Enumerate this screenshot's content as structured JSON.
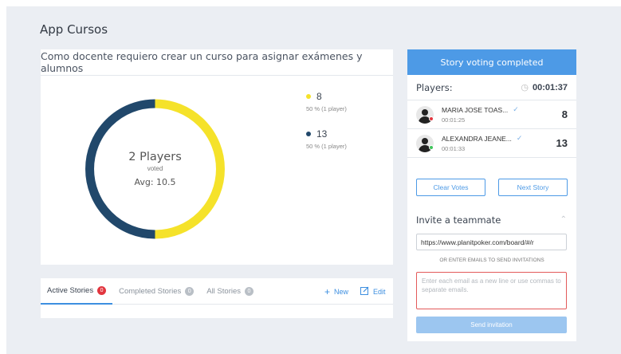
{
  "app_title": "App Cursos",
  "story": {
    "title": "Como docente requiero crear un curso para asignar exámenes y alumnos",
    "summary": {
      "players": "2 Players",
      "voted": "voted",
      "avg": "Avg: 10.5"
    },
    "legend": [
      {
        "value": "8",
        "detail": "50 % (1 player)",
        "color": "#f5e22a"
      },
      {
        "value": "13",
        "detail": "50 % (1 player)",
        "color": "#21486b"
      }
    ]
  },
  "chart_data": {
    "type": "pie",
    "categories": [
      "8",
      "13"
    ],
    "values": [
      50,
      50
    ],
    "colors": [
      "#f5e22a",
      "#21486b"
    ]
  },
  "tabs": {
    "items": [
      {
        "label": "Active Stories",
        "count": "0",
        "active": true
      },
      {
        "label": "Completed Stories",
        "count": "0",
        "active": false
      },
      {
        "label": "All Stories",
        "count": "0",
        "active": false
      }
    ],
    "new_label": "New",
    "edit_label": "Edit"
  },
  "sidebar": {
    "banner": "Story voting completed",
    "players_label": "Players:",
    "timer": "00:01:37",
    "players": [
      {
        "name": "MARIA JOSE TOAS...",
        "time": "00:01:25",
        "vote": "8",
        "status_color": "#e2363f"
      },
      {
        "name": "ALEXANDRA JEANE...",
        "time": "00:01:33",
        "vote": "13",
        "status_color": "#3ec35a"
      }
    ],
    "clear_votes": "Clear Votes",
    "next_story": "Next Story",
    "invite_title": "Invite a teammate",
    "invite_link": "https://www.planitpoker.com/board/#/r",
    "or_text": "OR ENTER EMAILS TO SEND INVITATIONS",
    "emails_placeholder": "Enter each email as a new line or use commas to separate emails.",
    "send_label": "Send invitation"
  }
}
